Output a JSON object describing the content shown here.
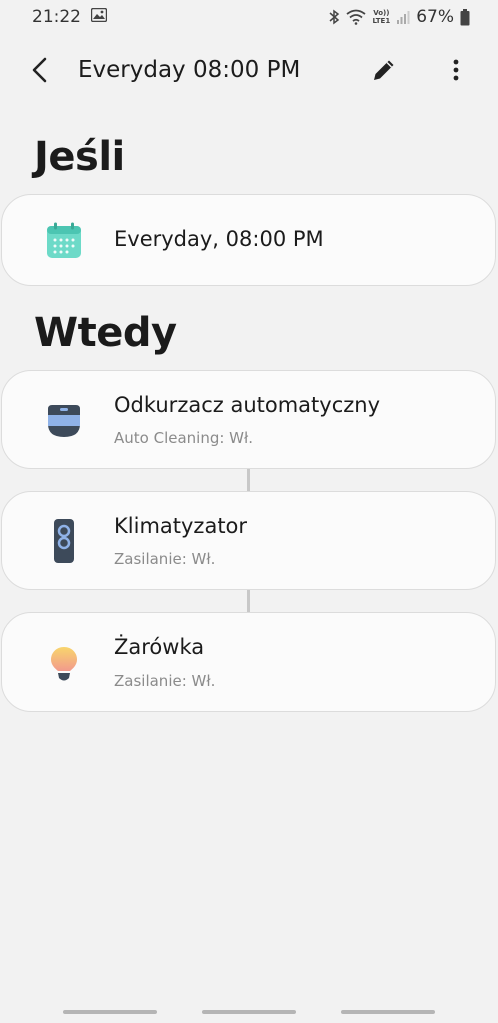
{
  "status": {
    "time": "21:22",
    "volte": "Vo))",
    "lte": "LTE1",
    "battery": "67%"
  },
  "app_bar": {
    "title": "Everyday 08:00 PM"
  },
  "if_section": {
    "heading": "Jeśli",
    "trigger": "Everyday, 08:00 PM"
  },
  "then_section": {
    "heading": "Wtedy",
    "actions": [
      {
        "title": "Odkurzacz automatyczny",
        "subtitle": "Auto Cleaning: Wł.",
        "icon": "robot-vacuum-icon"
      },
      {
        "title": "Klimatyzator",
        "subtitle": "Zasilanie: Wł.",
        "icon": "air-conditioner-icon"
      },
      {
        "title": "Żarówka",
        "subtitle": "Zasilanie: Wł.",
        "icon": "light-bulb-icon"
      }
    ]
  },
  "colors": {
    "background": "#f2f2f2",
    "card": "#fbfbfb",
    "calendar_teal": "#5fd3c0",
    "bulb_top": "#f9d26a",
    "bulb_bottom": "#f29c8a"
  }
}
